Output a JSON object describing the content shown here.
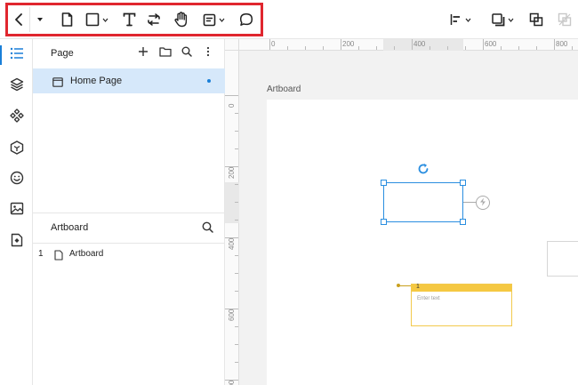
{
  "panel": {
    "page_section_title": "Page",
    "pages": [
      {
        "label": "Home Page"
      }
    ],
    "artboard_section_title": "Artboard",
    "artboards": [
      {
        "index": "1",
        "label": "Artboard"
      }
    ]
  },
  "canvas": {
    "artboard_label": "Artboard",
    "ruler_top_labels": [
      "0",
      "200",
      "400",
      "600",
      "800"
    ],
    "ruler_left_labels": [
      "0",
      "200",
      "400",
      "600",
      "800"
    ],
    "note": {
      "number": "1",
      "placeholder": "Enter text"
    }
  },
  "colors": {
    "accent": "#1a7fd8",
    "selection": "#2a8ee0",
    "highlight_frame": "#e0262e",
    "note": "#f5c842",
    "page_selected_bg": "#d6e8fa"
  },
  "icons": {
    "toolbar": [
      "back-icon",
      "dropdown-caret-icon",
      "page-icon",
      "rectangle-icon",
      "text-icon",
      "connector-icon",
      "hand-icon",
      "note-icon",
      "comment-icon",
      "align-icon",
      "arrange-icon",
      "group-icon",
      "ungroup-icon"
    ],
    "rail": [
      "outline-icon",
      "layers-icon",
      "components-icon",
      "shapes-icon",
      "emoji-icon",
      "image-icon",
      "plugin-icon"
    ]
  }
}
